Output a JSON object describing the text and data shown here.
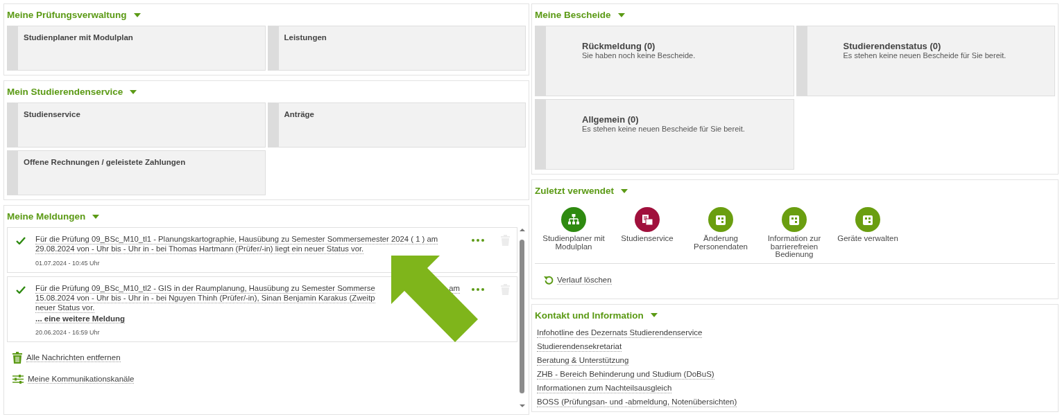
{
  "left_panels": [
    {
      "kind": "tiles",
      "title": "Meine Prüfungsverwaltung",
      "tiles": [
        {
          "label": "Studienplaner mit Modulplan"
        },
        {
          "label": "Leistungen"
        }
      ]
    },
    {
      "kind": "tiles",
      "title": "Mein Studierendenservice",
      "tiles": [
        {
          "label": "Studienservice"
        },
        {
          "label": "Anträge"
        },
        {
          "label": "Offene Rechnungen / geleistete Zahlungen"
        }
      ]
    },
    {
      "kind": "messages",
      "title": "Meine Meldungen",
      "messages": [
        {
          "lines": [
            [
              "Für die Prüfung 09_BSc_M10_tl1 - Planungskartographie, Hausübung zu Semester Sommersemester 2024 ( 1 ) am"
            ],
            [
              "29.08.2024 von - Uhr bis - Uhr in - bei Thomas Hartmann (Prüfer/-in) liegt ein neuer Status vor."
            ]
          ],
          "date": "01.07.2024 - 10:45 Uhr"
        },
        {
          "lines": [
            [
              "Für die Prüfung 09_BSc_M10_tl2 - GIS in der Raumplanung, Hausübung zu Semester Sommerse",
              "am"
            ],
            [
              "15.08.2024 von - Uhr bis - Uhr in - bei Nguyen Thinh (Prüfer/-in), Sinan Benjamin Karakus (Zweitp"
            ],
            [
              "neuer Status vor."
            ]
          ],
          "more": "... eine weitere Meldung",
          "date": "20.06.2024 - 16:59 Uhr"
        }
      ],
      "actions": [
        {
          "kind": "delete",
          "label": "Alle Nachrichten entfernen"
        },
        {
          "kind": "settings",
          "label": "Meine Kommunikationskanäle"
        }
      ]
    }
  ],
  "right_panels": [
    {
      "kind": "notices",
      "title": "Meine Bescheide",
      "tiles": [
        {
          "title": "Rückmeldung (0)",
          "text": "Sie haben noch keine Bescheide."
        },
        {
          "title": "Studierendenstatus (0)",
          "text": "Es stehen keine neuen Bescheide für Sie bereit."
        },
        {
          "title": "Allgemein (0)",
          "text": "Es stehen keine neuen Bescheide für Sie bereit."
        }
      ]
    },
    {
      "kind": "recent",
      "title": "Zuletzt verwendet",
      "items": [
        {
          "kind": "sitemap",
          "color": "#2e8a10",
          "label": "Studienplaner mit Modulplan"
        },
        {
          "kind": "documents",
          "color": "#a0103c",
          "label": "Studienservice"
        },
        {
          "kind": "app",
          "color": "#6a9e10",
          "label": "Änderung Personendaten"
        },
        {
          "kind": "app",
          "color": "#6a9e10",
          "label": "Information zur barrierefreien Bedienung"
        },
        {
          "kind": "app",
          "color": "#6a9e10",
          "label": "Geräte verwalten"
        }
      ],
      "clear": "Verlauf löschen"
    },
    {
      "kind": "links",
      "title": "Kontakt und Information",
      "links": [
        "Infohotline des Dezernats Studierendenservice",
        "Studierendensekretariat",
        "Beratung & Unterstützung",
        "ZHB - Bereich Behinderung und Studium (DoBuS)",
        "Informationen zum Nachteilsausgleich",
        "BOSS (Prüfungsan- und -abmeldung, Notenübersichten)"
      ]
    }
  ]
}
